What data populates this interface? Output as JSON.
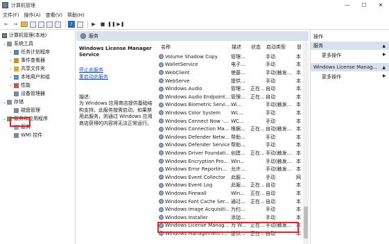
{
  "window": {
    "title": "计算机管理",
    "controls": [
      "—",
      "☐",
      "✕"
    ]
  },
  "menu": [
    "文件(F)",
    "操作(A)",
    "查看(V)",
    "帮助(H)"
  ],
  "tree": {
    "root": "计算机管理(本地)",
    "items": [
      {
        "label": "系统工具",
        "level": 1,
        "chev": "⌄"
      },
      {
        "label": "任务计划程序",
        "level": 2,
        "chev": "›"
      },
      {
        "label": "事件查看器",
        "level": 2,
        "chev": "›"
      },
      {
        "label": "共享文件夹",
        "level": 2,
        "chev": "›"
      },
      {
        "label": "本地用户和组",
        "level": 2,
        "chev": "›"
      },
      {
        "label": "性能",
        "level": 2,
        "chev": "›"
      },
      {
        "label": "设备管理器",
        "level": 2,
        "chev": ""
      },
      {
        "label": "存储",
        "level": 1,
        "chev": "⌄"
      },
      {
        "label": "磁盘管理",
        "level": 2,
        "chev": ""
      },
      {
        "label": "服务和应用程序",
        "level": 1,
        "chev": "⌄"
      },
      {
        "label": "服务",
        "level": 2,
        "chev": ""
      },
      {
        "label": "WMI 控件",
        "level": 2,
        "chev": ""
      }
    ]
  },
  "middle": {
    "header": "服务",
    "service_title": "Windows License Manager Service",
    "links": [
      "停止此服务",
      "重启动此服务"
    ],
    "desc_label": "描述:",
    "description": "为 Windows 应用商店提供基础结构支持。此服务按需启动，如果禁用此服务，则通过 Windows 应用商店获得的内容将无法正常运行。"
  },
  "table": {
    "columns": [
      "名称",
      "描述",
      "状态",
      "启动类型",
      "登"
    ],
    "rows": [
      [
        "Volume Shadow Copy",
        "管理...",
        "",
        "手动",
        "本"
      ],
      [
        "WalletService",
        "电子...",
        "",
        "手动",
        "本"
      ],
      [
        "WebClient",
        "使基...",
        "",
        "手动(触发...",
        "本"
      ],
      [
        "WebServe",
        "提供...",
        "",
        "手动",
        "本"
      ],
      [
        "Windows Audio",
        "管理...",
        "正在...",
        "自动",
        "本"
      ],
      [
        "Windows Audio Endpoint...",
        "管理...",
        "正在...",
        "自动",
        "本"
      ],
      [
        "Windows Biometric Servi...",
        "Wi...",
        "",
        "手动(触发...",
        "本"
      ],
      [
        "Windows Color System",
        "Wc...",
        "",
        "手动",
        "本"
      ],
      [
        "Windows Connect Now -...",
        "WC...",
        "",
        "手动",
        "本"
      ],
      [
        "Windows Connection Ma...",
        "根据...",
        "正在...",
        "自动(触发...",
        "本"
      ],
      [
        "Windows Defender Netw...",
        "帮助...",
        "",
        "手动",
        "本"
      ],
      [
        "Windows Defender Service",
        "帮助...",
        "",
        "手动",
        "本"
      ],
      [
        "Windows Driver Foundati...",
        "创建...",
        "正在...",
        "手动(触发...",
        "本"
      ],
      [
        "Windows Encryption Pro...",
        "Win...",
        "",
        "手动(触发...",
        "本"
      ],
      [
        "Windows Error Reportin...",
        "允许...",
        "",
        "手动(触发...",
        "本"
      ],
      [
        "Windows Event Collector",
        "此服...",
        "",
        "手动",
        "网"
      ],
      [
        "Windows Event Log",
        "此服...",
        "正在...",
        "自动",
        "本"
      ],
      [
        "Windows Firewall",
        "Win...",
        "正在...",
        "自动",
        "本"
      ],
      [
        "Windows Font Cache Ser...",
        "通过...",
        "正在...",
        "自动",
        "本"
      ],
      [
        "Windows Image Acquisiti...",
        "为扫...",
        "",
        "手动",
        "本"
      ],
      [
        "Windows Installer",
        "添加...",
        "",
        "手动",
        "本"
      ],
      [
        "Windows License Manag...",
        "为 W...",
        "正在...",
        "手动(触发...",
        "本"
      ],
      [
        "Windows Management I...",
        "提供...",
        "正在...",
        "自动",
        "本"
      ]
    ]
  },
  "actions": {
    "header": "操作",
    "section1": "服务",
    "more1": "更多操作",
    "section2": "Windows License Manag...",
    "more2": "更多操作"
  },
  "colors": {
    "highlight": "#e0262b",
    "pane_header": "#d8e1ec",
    "link": "#1f4fbf"
  }
}
